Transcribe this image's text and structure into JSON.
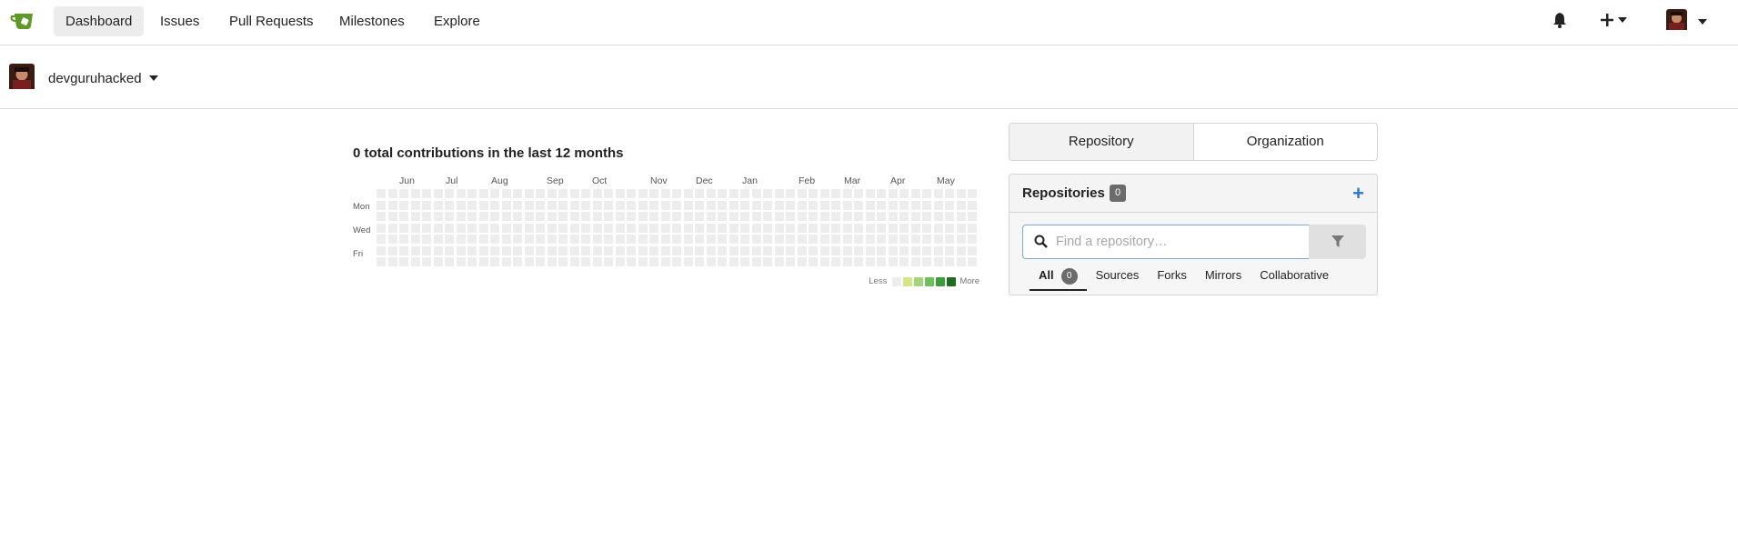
{
  "nav": {
    "items": [
      {
        "label": "Dashboard",
        "active": true
      },
      {
        "label": "Issues"
      },
      {
        "label": "Pull Requests"
      },
      {
        "label": "Milestones"
      },
      {
        "label": "Explore"
      }
    ],
    "icons": [
      "bell-icon",
      "plus-icon",
      "avatar"
    ]
  },
  "context": {
    "username": "devguruhacked"
  },
  "heatmap": {
    "title": "0 total contributions in the last 12 months",
    "months": [
      "Jun",
      "Jul",
      "Aug",
      "Sep",
      "Oct",
      "Nov",
      "Dec",
      "Jan",
      "Feb",
      "Mar",
      "Apr",
      "May"
    ],
    "days": [
      "Mon",
      "Wed",
      "Fri"
    ],
    "legend_less": "Less",
    "legend_more": "More",
    "legend_colors": [
      "#ededed",
      "#d6e685",
      "#a3d67a",
      "#6cc05c",
      "#3f9c3a",
      "#1f6b1f"
    ]
  },
  "switcher": {
    "repository": "Repository",
    "organization": "Organization"
  },
  "repos": {
    "title": "Repositories",
    "count": "0",
    "search_placeholder": "Find a repository…",
    "tabs": {
      "all": "All",
      "all_count": "0",
      "sources": "Sources",
      "forks": "Forks",
      "mirrors": "Mirrors",
      "collaborative": "Collaborative"
    }
  },
  "colors": {
    "accent": "#2a7ac7",
    "logo_green": "#609926"
  }
}
